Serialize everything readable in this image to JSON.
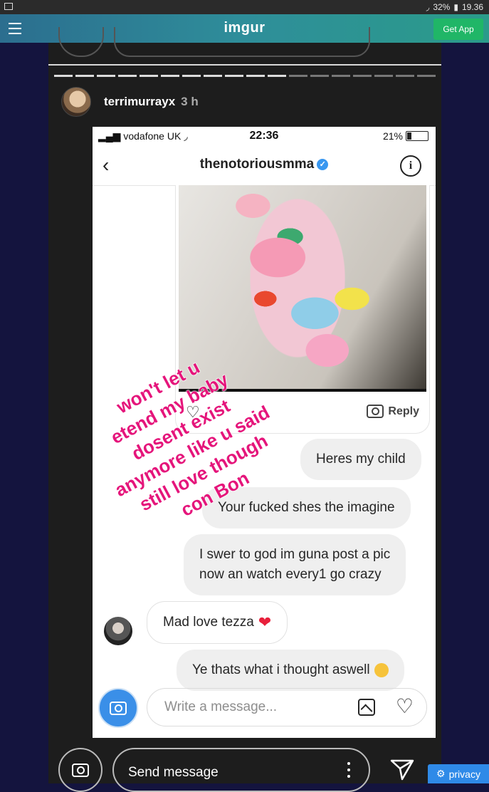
{
  "status_bar": {
    "battery": "32%",
    "time": "19.36"
  },
  "header": {
    "logo": "imgur",
    "get_app": "Get App"
  },
  "story": {
    "username": "terrimurrayx",
    "time_ago": "3 h",
    "progress": {
      "segments": 18,
      "viewed": 11
    }
  },
  "screenshot": {
    "carrier": "vodafone UK",
    "clock": "22:36",
    "battery": "21%",
    "thread_title": "thenotoriousmma",
    "reply_label": "Reply",
    "messages": [
      {
        "text": "Heres my child"
      },
      {
        "text": "Your fucked shes the imagine"
      },
      {
        "line1": "I swer to god im guna post a pic",
        "line2": "now an watch every1 go crazy"
      },
      {
        "text": "Mad love tezza"
      },
      {
        "text": "Ye thats what i thought aswell"
      }
    ],
    "composer_placeholder": "Write a message..."
  },
  "overlay_text": [
    "won't let u",
    "etend my baby",
    "dosent exist",
    "anymore like u said",
    "still love though",
    "con Bon"
  ],
  "bottom": {
    "placeholder": "Send message"
  },
  "privacy": {
    "label": "privacy"
  }
}
